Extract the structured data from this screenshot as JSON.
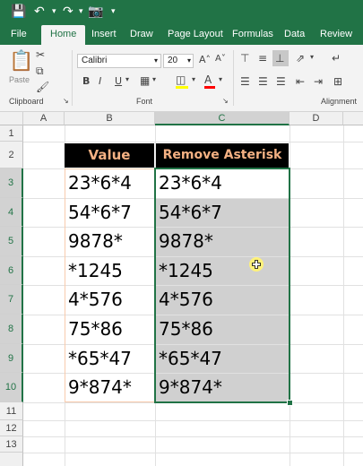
{
  "quick_access": {
    "save_icon": "save-icon",
    "undo_icon": "undo-icon",
    "redo_icon": "redo-icon",
    "camera_icon": "camera-icon"
  },
  "ribbon_tabs": [
    "File",
    "Home",
    "Insert",
    "Draw",
    "Page Layout",
    "Formulas",
    "Data",
    "Review"
  ],
  "ribbon": {
    "paste_label": "Paste",
    "clipboard_label": "Clipboard",
    "font_label": "Font",
    "alignment_label": "Alignment",
    "font_name": "Calibri",
    "font_size": "20",
    "bold": "B",
    "italic": "I",
    "underline": "U",
    "grow_font": "A˄",
    "shrink_font": "A˅"
  },
  "columns": [
    "A",
    "B",
    "C",
    "D"
  ],
  "rows": [
    "1",
    "2",
    "3",
    "4",
    "5",
    "6",
    "7",
    "8",
    "9",
    "10",
    "11",
    "12",
    "13"
  ],
  "table": {
    "header_value": "Value",
    "header_remove": "Remove Asterisk",
    "values": [
      "23*6*4",
      "54*6*7",
      "9878*",
      "*1245",
      "4*576",
      "75*86",
      "*65*47",
      "9*874*"
    ],
    "removed": [
      "23*6*4",
      "54*6*7",
      "9878*",
      "*1245",
      "4*576",
      "75*86",
      "*65*47",
      "9*874*"
    ]
  },
  "colors": {
    "accent": "#217346",
    "header_bg": "#000000",
    "header_text": "#f4b183",
    "selection": "#d0d0d0"
  }
}
